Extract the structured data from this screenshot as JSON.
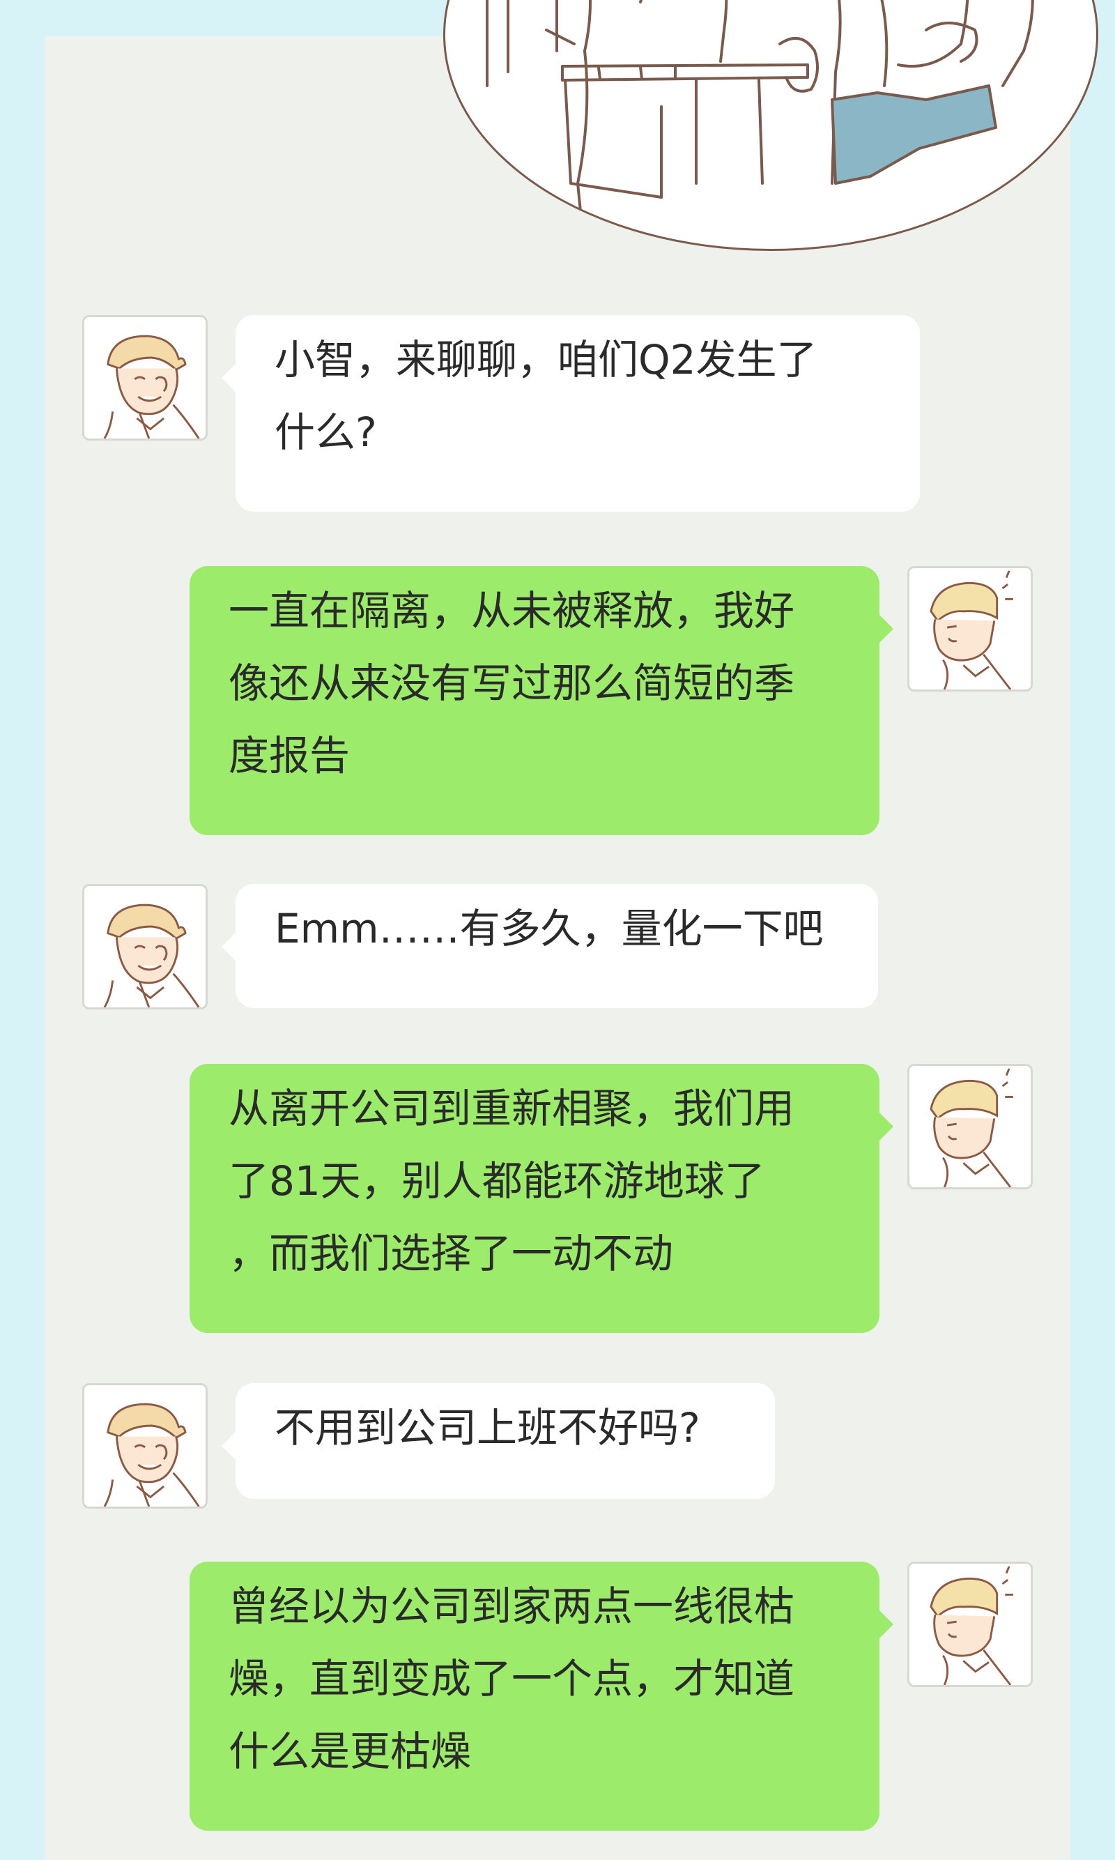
{
  "chat": {
    "messages": [
      {
        "sender": "manager",
        "lines": [
          "小智，来聊聊，咱们Q2发生了",
          "什么?"
        ]
      },
      {
        "sender": "xiaozhi",
        "lines": [
          "一直在隔离，从未被释放，我好",
          "像还从来没有写过那么简短的季",
          "度报告"
        ]
      },
      {
        "sender": "manager",
        "lines": [
          "Emm……有多久，量化一下吧"
        ]
      },
      {
        "sender": "xiaozhi",
        "lines": [
          "从离开公司到重新相聚，我们用",
          "了81天，别人都能环游地球了",
          "，而我们选择了一动不动"
        ]
      },
      {
        "sender": "manager",
        "lines": [
          "不用到公司上班不好吗?"
        ]
      },
      {
        "sender": "xiaozhi",
        "lines": [
          "曾经以为公司到家两点一线很枯",
          "燥，直到变成了一个点，才知道",
          "什么是更枯燥"
        ]
      }
    ]
  },
  "colors": {
    "page_background": "#d8f3f7",
    "panel_background": "#eef1ec",
    "incoming_bubble": "#ffffff",
    "outgoing_bubble": "#9ceb6b",
    "text": "#2a2a2a",
    "line_art": "#7a5a4c",
    "denim": "#8ab6c6"
  }
}
